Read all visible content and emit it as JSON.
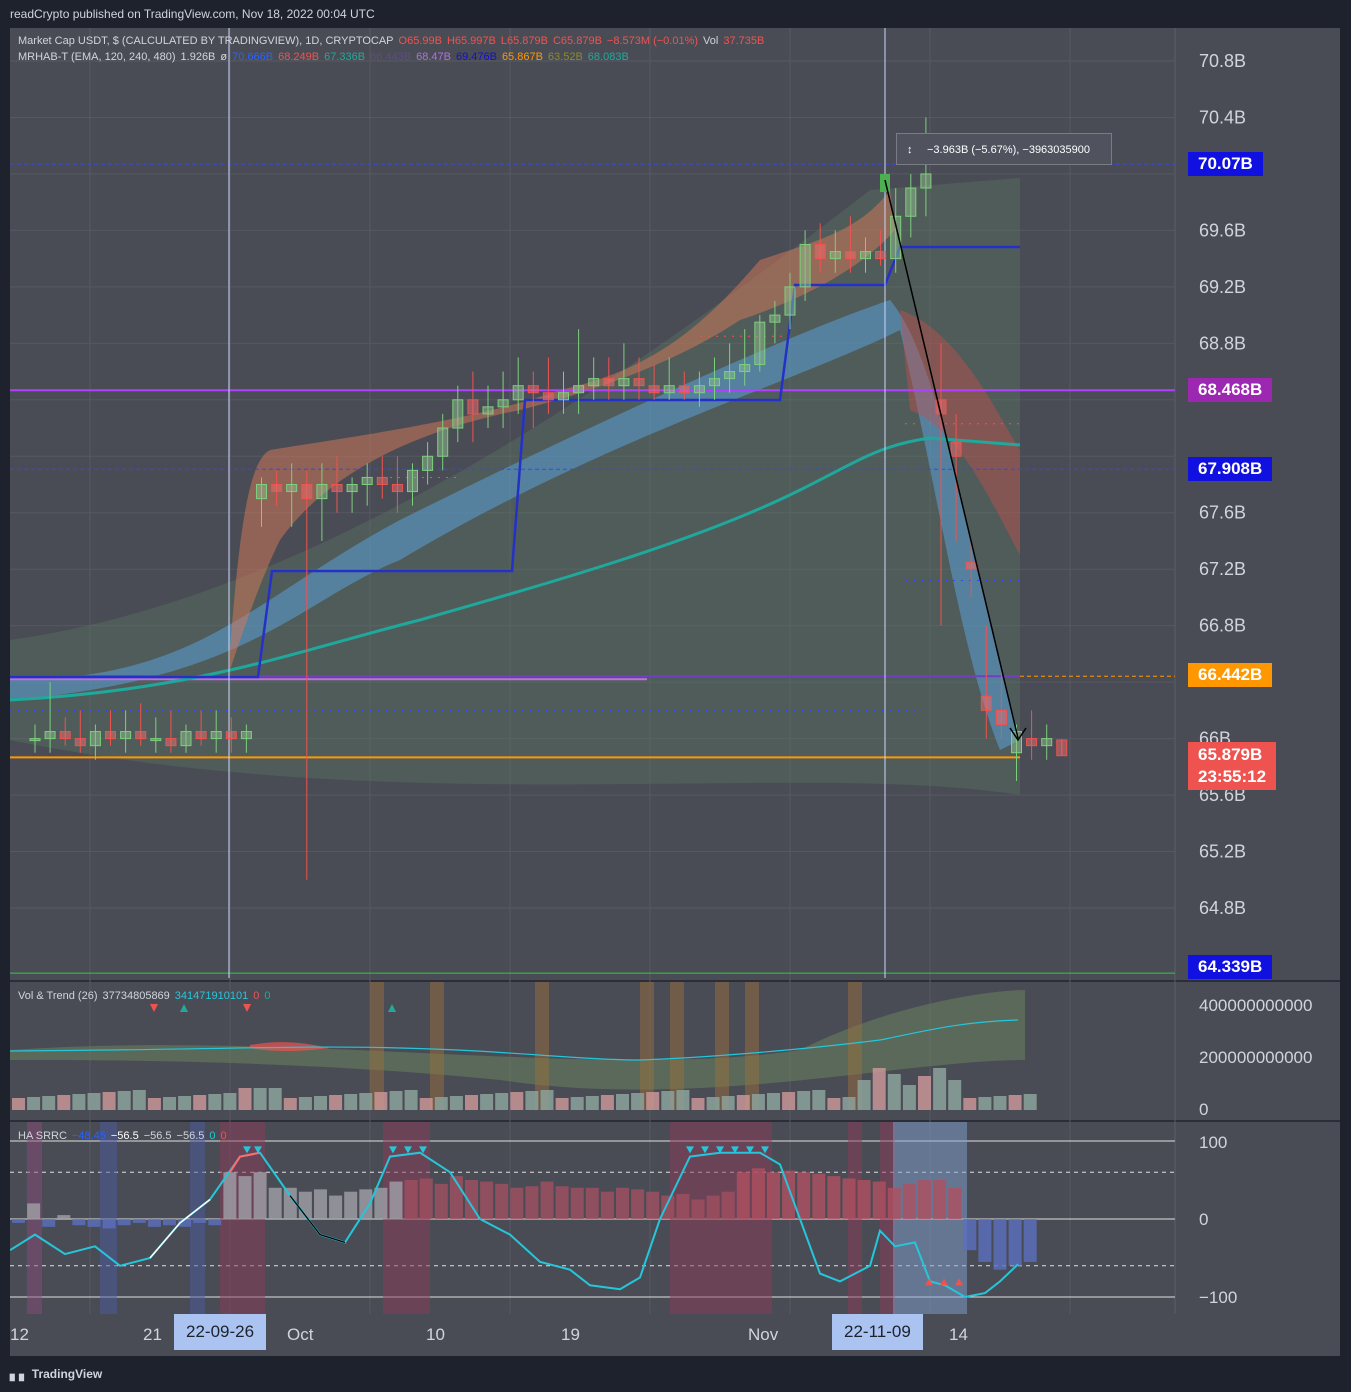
{
  "header": {
    "publisher_text": "readCrypto published on TradingView.com, Nov 18, 2022 00:04 UTC"
  },
  "legend_main": {
    "line1": [
      {
        "text": "Market Cap USDT, $ (CALCULATED BY TRADINGVIEW), 1D, CRYPTOCAP",
        "color": "#d1d4dc"
      },
      {
        "text": "O65.99B",
        "color": "#ef5350"
      },
      {
        "text": "H65.997B",
        "color": "#ef5350"
      },
      {
        "text": "L65.879B",
        "color": "#ef5350"
      },
      {
        "text": "C65.879B",
        "color": "#ef5350"
      },
      {
        "text": "−8.573M (−0.01%)",
        "color": "#ef5350"
      },
      {
        "text": "Vol",
        "color": "#d1d4dc"
      },
      {
        "text": "37.735B",
        "color": "#ef5350"
      }
    ],
    "line2": [
      {
        "text": "MRHAB-T (EMA, 120, 240, 480)",
        "color": "#d1d4dc"
      },
      {
        "text": "1.926B",
        "color": "#d1d4dc"
      },
      {
        "text": "ø",
        "color": "#d1d4dc"
      },
      {
        "text": "70.666B",
        "color": "#2962ff"
      },
      {
        "text": "68.249B",
        "color": "#ef5350"
      },
      {
        "text": "67.336B",
        "color": "#26a69a"
      },
      {
        "text": "66.443B",
        "color": "#5d4a8a"
      },
      {
        "text": "68.47B",
        "color": "#b070e0"
      },
      {
        "text": "69.476B",
        "color": "#1010d0"
      },
      {
        "text": "65.867B",
        "color": "#ff9800"
      },
      {
        "text": "63.52B",
        "color": "#8a8a30"
      },
      {
        "text": "68.083B",
        "color": "#26a69a"
      }
    ]
  },
  "legend_vol": {
    "items": [
      {
        "text": "Vol & Trend (26)",
        "color": "#d1d4dc"
      },
      {
        "text": "37734805869",
        "color": "#d1d4dc"
      },
      {
        "text": "341471910101",
        "color": "#26c6da"
      },
      {
        "text": "0",
        "color": "#ef5350"
      },
      {
        "text": "0",
        "color": "#26a69a"
      }
    ]
  },
  "legend_ha": {
    "items": [
      {
        "text": "HA SRRC",
        "color": "#d1d4dc"
      },
      {
        "text": "−48.45",
        "color": "#2962ff"
      },
      {
        "text": "−56.5",
        "color": "#ffffff"
      },
      {
        "text": "−56.5",
        "color": "#d1d4dc"
      },
      {
        "text": "−56.5",
        "color": "#d1d4dc"
      },
      {
        "text": "0",
        "color": "#26c6da"
      },
      {
        "text": "0",
        "color": "#ef5350"
      }
    ]
  },
  "badges": {
    "b1": {
      "text": "70.07B",
      "color": "#1010e0"
    },
    "b2": {
      "text": "68.468B",
      "color": "#9c27b0"
    },
    "b3": {
      "text": "67.908B",
      "color": "#1010e0"
    },
    "b4": {
      "text": "66.442B",
      "color": "#ff9800"
    },
    "b5": {
      "text": "65.879B",
      "color": "#ef5350"
    },
    "b5_timer": "23:55:12",
    "b6": {
      "text": "64.339B",
      "color": "#1010e0"
    }
  },
  "measure_tooltip": "−3.963B (−5.67%), −3963035900",
  "x_axis": {
    "labels": [
      "12",
      "21",
      "Oct",
      "10",
      "19",
      "Nov",
      "14"
    ],
    "highlight_left": "22-09-26",
    "highlight_right": "22-11-09"
  },
  "footer": {
    "brand": "TradingView"
  },
  "chart_data": [
    {
      "type": "candlestick",
      "title": "Market Cap USDT, $ (CALCULATED BY TRADINGVIEW), 1D, CRYPTOCAP",
      "y_axis_ticks": [
        "70.8B",
        "70.4B",
        "69.6B",
        "69.2B",
        "68.8B",
        "67.6B",
        "67.2B",
        "66.8B",
        "66B",
        "65.6B",
        "65.2B",
        "64.8B"
      ],
      "ylim": [
        64.3,
        71.0
      ],
      "unit": "B USD",
      "ohlc_approx": [
        [
          66.0,
          66.1,
          65.9,
          66.0
        ],
        [
          66.0,
          66.4,
          65.9,
          66.05
        ],
        [
          66.05,
          66.15,
          65.95,
          66.0
        ],
        [
          66.0,
          66.2,
          65.9,
          65.95
        ],
        [
          65.95,
          66.1,
          65.85,
          66.05
        ],
        [
          66.05,
          66.2,
          65.95,
          66.0
        ],
        [
          66.0,
          66.2,
          65.9,
          66.05
        ],
        [
          66.05,
          66.25,
          65.95,
          66.0
        ],
        [
          66.0,
          66.15,
          65.9,
          66.0
        ],
        [
          66.0,
          66.2,
          65.9,
          65.95
        ],
        [
          65.95,
          66.1,
          65.9,
          66.05
        ],
        [
          66.05,
          66.2,
          65.95,
          66.0
        ],
        [
          66.0,
          66.2,
          65.9,
          66.05
        ],
        [
          66.05,
          66.15,
          65.9,
          66.0
        ],
        [
          66.0,
          66.1,
          65.9,
          66.05
        ],
        [
          67.7,
          67.85,
          67.5,
          67.8
        ],
        [
          67.8,
          67.9,
          67.65,
          67.75
        ],
        [
          67.75,
          67.95,
          67.5,
          67.8
        ],
        [
          67.8,
          67.9,
          65.0,
          67.7
        ],
        [
          67.7,
          67.95,
          67.4,
          67.8
        ],
        [
          67.8,
          68.0,
          67.6,
          67.75
        ],
        [
          67.75,
          67.85,
          67.6,
          67.8
        ],
        [
          67.8,
          67.95,
          67.65,
          67.85
        ],
        [
          67.85,
          68.0,
          67.7,
          67.8
        ],
        [
          67.8,
          68.0,
          67.6,
          67.75
        ],
        [
          67.75,
          67.95,
          67.65,
          67.9
        ],
        [
          67.9,
          68.1,
          67.8,
          68.0
        ],
        [
          68.0,
          68.3,
          67.9,
          68.2
        ],
        [
          68.2,
          68.5,
          68.1,
          68.4
        ],
        [
          68.4,
          68.6,
          68.1,
          68.3
        ],
        [
          68.3,
          68.5,
          68.2,
          68.35
        ],
        [
          68.35,
          68.6,
          68.2,
          68.4
        ],
        [
          68.4,
          68.7,
          68.3,
          68.5
        ],
        [
          68.5,
          68.6,
          68.2,
          68.45
        ],
        [
          68.45,
          68.7,
          68.3,
          68.4
        ],
        [
          68.4,
          68.6,
          68.3,
          68.45
        ],
        [
          68.45,
          68.9,
          68.3,
          68.5
        ],
        [
          68.5,
          68.7,
          68.4,
          68.55
        ],
        [
          68.55,
          68.7,
          68.4,
          68.5
        ],
        [
          68.5,
          68.8,
          68.4,
          68.55
        ],
        [
          68.55,
          68.7,
          68.4,
          68.5
        ],
        [
          68.5,
          68.65,
          68.4,
          68.45
        ],
        [
          68.45,
          68.7,
          68.4,
          68.5
        ],
        [
          68.5,
          68.6,
          68.4,
          68.45
        ],
        [
          68.45,
          68.6,
          68.35,
          68.5
        ],
        [
          68.5,
          68.7,
          68.4,
          68.55
        ],
        [
          68.55,
          68.8,
          68.45,
          68.6
        ],
        [
          68.6,
          68.9,
          68.5,
          68.65
        ],
        [
          68.65,
          69.0,
          68.6,
          68.95
        ],
        [
          68.95,
          69.1,
          68.8,
          69.0
        ],
        [
          69.0,
          69.3,
          68.9,
          69.2
        ],
        [
          69.2,
          69.6,
          69.1,
          69.5
        ],
        [
          69.5,
          69.65,
          69.3,
          69.4
        ],
        [
          69.4,
          69.6,
          69.3,
          69.45
        ],
        [
          69.45,
          69.7,
          69.3,
          69.4
        ],
        [
          69.4,
          69.55,
          69.3,
          69.45
        ],
        [
          69.45,
          69.6,
          69.35,
          69.4
        ],
        [
          69.4,
          69.9,
          69.3,
          69.7
        ],
        [
          69.7,
          70.0,
          69.55,
          69.9
        ],
        [
          69.9,
          70.4,
          69.7,
          70.0
        ],
        [
          68.4,
          68.8,
          66.8,
          68.3
        ],
        [
          68.1,
          68.3,
          67.4,
          68.0
        ],
        [
          67.25,
          67.4,
          67.0,
          67.2
        ],
        [
          66.3,
          66.8,
          66.0,
          66.2
        ],
        [
          66.2,
          66.5,
          66.0,
          66.1
        ],
        [
          65.9,
          66.1,
          65.7,
          66.05
        ],
        [
          66.0,
          66.2,
          65.85,
          65.95
        ],
        [
          65.95,
          66.1,
          65.85,
          66.0
        ],
        [
          65.99,
          65.997,
          65.879,
          65.879
        ]
      ],
      "levels": [
        {
          "name": "70.07B",
          "value": 70.07
        },
        {
          "name": "68.468B",
          "value": 68.468
        },
        {
          "name": "67.908B",
          "value": 67.908
        },
        {
          "name": "66.442B",
          "value": 66.442
        },
        {
          "name": "65.879B",
          "value": 65.879
        },
        {
          "name": "64.339B",
          "value": 64.339
        }
      ]
    },
    {
      "type": "bar",
      "title": "Vol & Trend (26)",
      "y_axis_ticks": [
        "400000000000",
        "200000000000",
        "0"
      ],
      "ylim": [
        0,
        480000000000
      ]
    },
    {
      "type": "line",
      "title": "HA SRRC",
      "y_axis_ticks": [
        "100",
        "0",
        "−100"
      ],
      "ylim": [
        -110,
        110
      ]
    }
  ]
}
